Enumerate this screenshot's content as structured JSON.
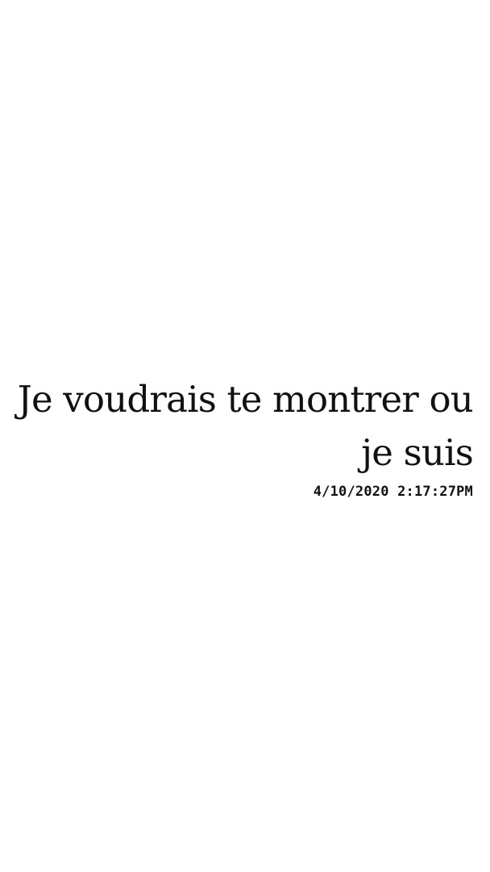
{
  "message": {
    "text": "Je voudrais te montrer ou je suis",
    "timestamp": "4/10/2020 2:17:27PM"
  },
  "colors": {
    "background": "#ffffff",
    "text": "#111111"
  }
}
